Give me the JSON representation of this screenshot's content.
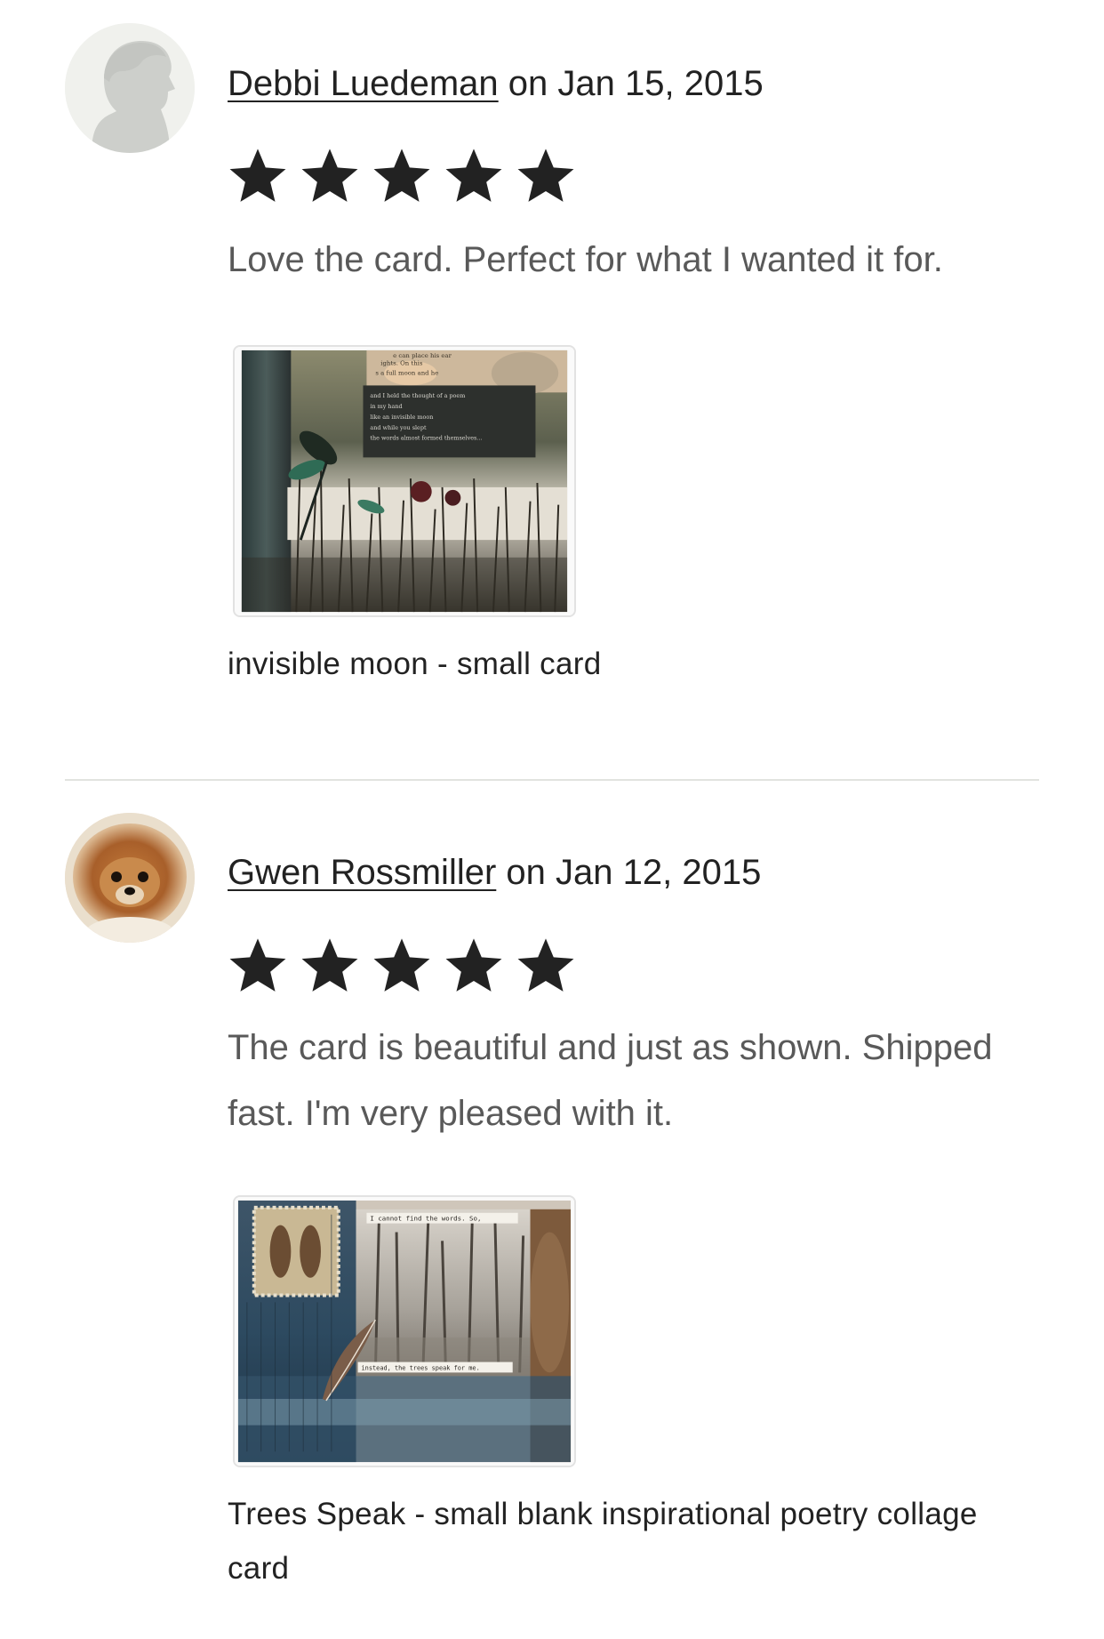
{
  "reviews": [
    {
      "reviewer": "Debbi Luedeman",
      "date_prefix": " on ",
      "date": "Jan 15, 2015",
      "rating": 5,
      "text": "Love the card. Perfect for what I wanted it for.",
      "item_title": "invisible moon - small card",
      "avatar_icon": "default-user-silhouette-icon",
      "thumbnail_text": {
        "top": "e can place his ear\nights. On this\ns a full moon and he",
        "poem": "and I held the thought of a poem\nin my hand\nlike an invisible moon\nand while you slept\nthe words almost formed themselves..."
      }
    },
    {
      "reviewer": "Gwen Rossmiller",
      "date_prefix": " on ",
      "date": "Jan 12, 2015",
      "rating": 5,
      "text": "The card is beautiful and just as shown. Shipped fast. I'm very pleased with it.",
      "item_title": "Trees Speak - small blank inspirational poetry collage card",
      "avatar_icon": "pomeranian-photo",
      "thumbnail_text": {
        "top": "I cannot find the words.  So,",
        "bottom": "instead, the trees speak for me."
      }
    }
  ],
  "colors": {
    "primary_text": "#222222",
    "secondary_text": "#595959",
    "divider": "#e1e3df",
    "star": "#222222"
  }
}
